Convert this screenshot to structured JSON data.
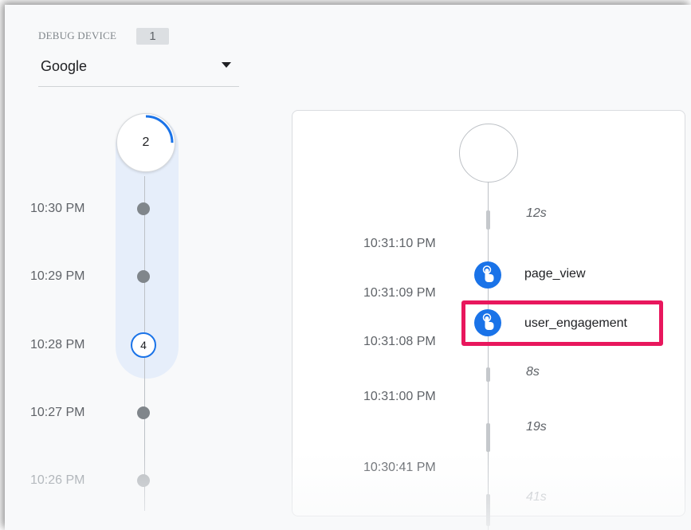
{
  "device_selector": {
    "label": "DEBUG DEVICE",
    "count": "1",
    "selected": "Google"
  },
  "minutes_stream": {
    "top_bubble_count": "2",
    "top_bubble_progress_fraction": 0.25,
    "rows": [
      {
        "time": "10:30 PM",
        "marker": "dot"
      },
      {
        "time": "10:29 PM",
        "marker": "dot"
      },
      {
        "time": "10:28 PM",
        "marker": "count",
        "count": "4"
      },
      {
        "time": "10:27 PM",
        "marker": "dot"
      },
      {
        "time": "10:26 PM",
        "marker": "dot"
      }
    ]
  },
  "seconds_stream": {
    "gap_labels": [
      "12s",
      "8s",
      "19s",
      "41s"
    ],
    "timestamps": [
      "10:31:10 PM",
      "10:31:09 PM",
      "10:31:08 PM",
      "10:31:00 PM",
      "10:30:41 PM"
    ],
    "events": [
      {
        "name": "page_view",
        "icon": "touch-icon"
      },
      {
        "name": "user_engagement",
        "icon": "touch-icon",
        "highlighted": true
      }
    ]
  },
  "colors": {
    "accent": "#1a73e8",
    "highlight": "#e8175d",
    "track": "#e6eefa"
  }
}
